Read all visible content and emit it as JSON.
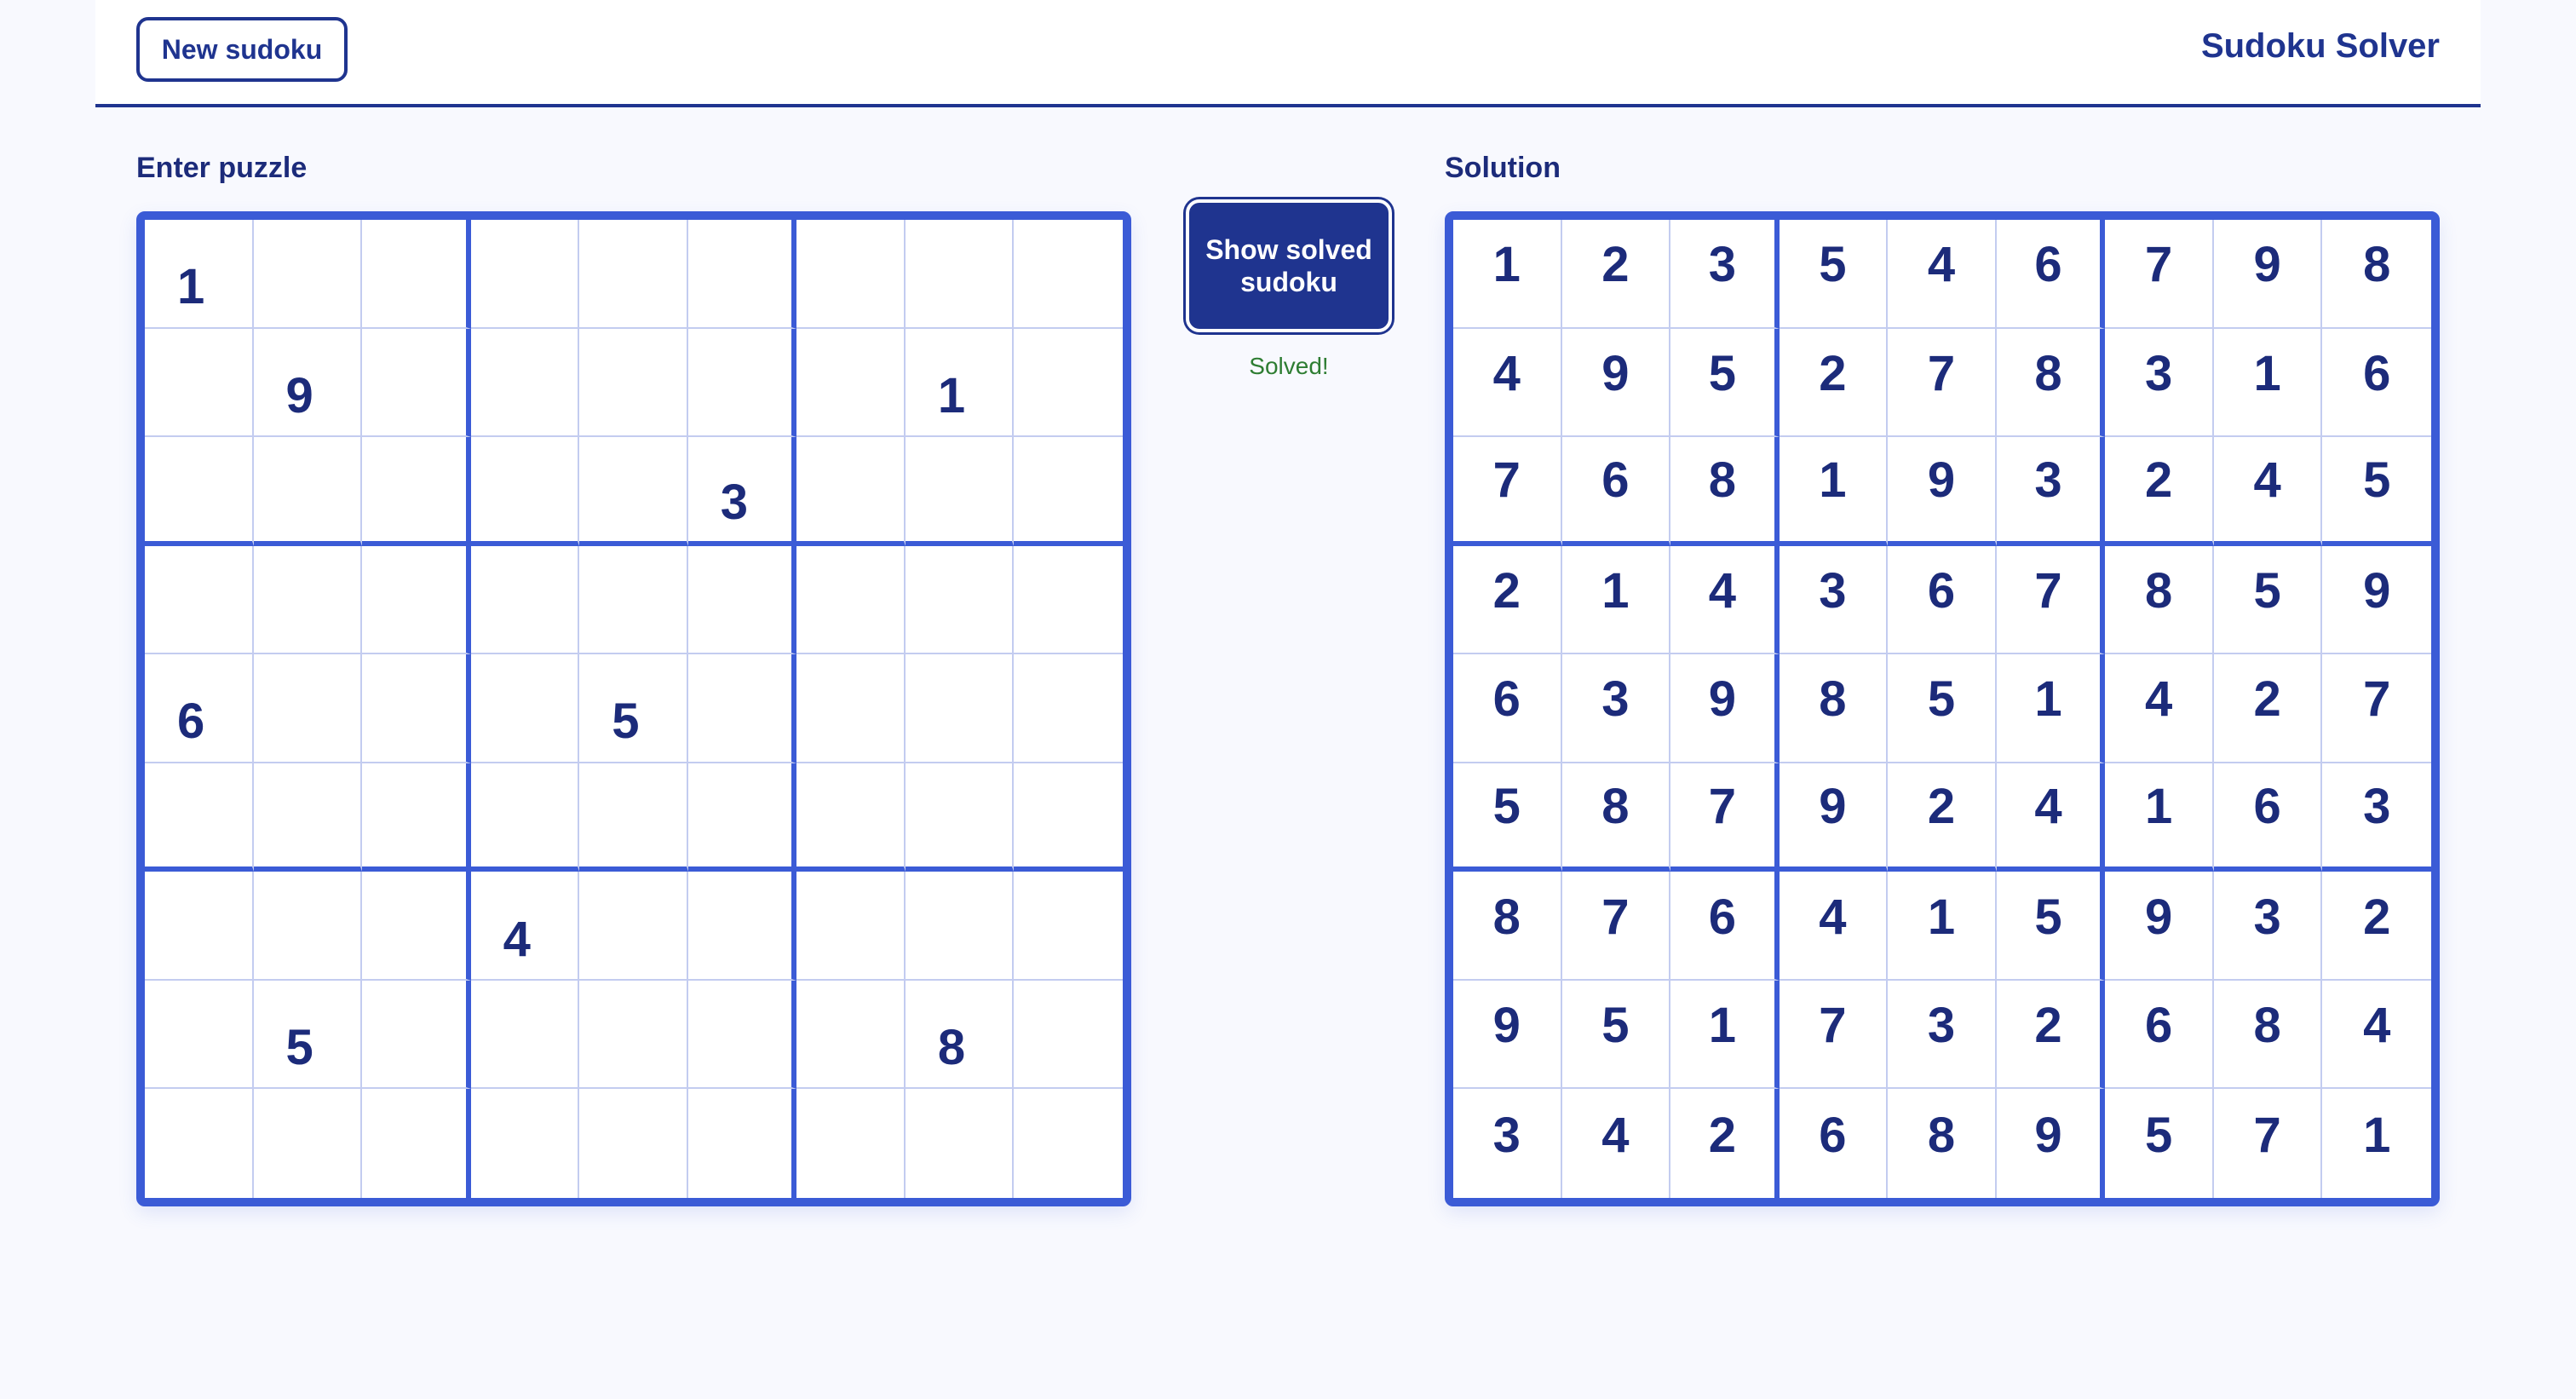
{
  "header": {
    "new_button_label": "New sudoku",
    "app_title": "Sudoku Solver"
  },
  "puzzle": {
    "label": "Enter puzzle",
    "grid": [
      [
        "1",
        "",
        "",
        "",
        "",
        "",
        "",
        "",
        ""
      ],
      [
        "",
        "9",
        "",
        "",
        "",
        "",
        "",
        "1",
        ""
      ],
      [
        "",
        "",
        "",
        "",
        "",
        "3",
        "",
        "",
        ""
      ],
      [
        "",
        "",
        "",
        "",
        "",
        "",
        "",
        "",
        ""
      ],
      [
        "6",
        "",
        "",
        "",
        "5",
        "",
        "",
        "",
        ""
      ],
      [
        "",
        "",
        "",
        "",
        "",
        "",
        "",
        "",
        ""
      ],
      [
        "",
        "",
        "",
        "4",
        "",
        "",
        "",
        "",
        ""
      ],
      [
        "",
        "5",
        "",
        "",
        "",
        "",
        "",
        "8",
        ""
      ],
      [
        "",
        "",
        "",
        "",
        "",
        "",
        "",
        "",
        ""
      ]
    ]
  },
  "controls": {
    "solve_button_label": "Show solved sudoku",
    "status_text": "Solved!",
    "status_color": "#2e7d32"
  },
  "solution": {
    "label": "Solution",
    "grid": [
      [
        "1",
        "2",
        "3",
        "5",
        "4",
        "6",
        "7",
        "9",
        "8"
      ],
      [
        "4",
        "9",
        "5",
        "2",
        "7",
        "8",
        "3",
        "1",
        "6"
      ],
      [
        "7",
        "6",
        "8",
        "1",
        "9",
        "3",
        "2",
        "4",
        "5"
      ],
      [
        "2",
        "1",
        "4",
        "3",
        "6",
        "7",
        "8",
        "5",
        "9"
      ],
      [
        "6",
        "3",
        "9",
        "8",
        "5",
        "1",
        "4",
        "2",
        "7"
      ],
      [
        "5",
        "8",
        "7",
        "9",
        "2",
        "4",
        "1",
        "6",
        "3"
      ],
      [
        "8",
        "7",
        "6",
        "4",
        "1",
        "5",
        "9",
        "3",
        "2"
      ],
      [
        "9",
        "5",
        "1",
        "7",
        "3",
        "2",
        "6",
        "8",
        "4"
      ],
      [
        "3",
        "4",
        "2",
        "6",
        "8",
        "9",
        "5",
        "7",
        "1"
      ]
    ]
  },
  "colors": {
    "accent": "#3b5bd6",
    "primary": "#1f348f",
    "text": "#1c2b7a",
    "grid_line": "#c3ccf0",
    "background": "#f8f9fe"
  }
}
